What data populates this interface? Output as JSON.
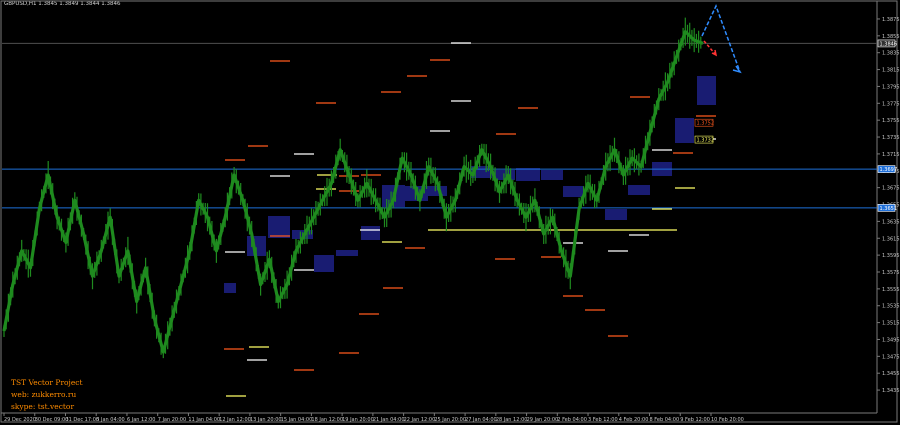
{
  "chart_header": {
    "symbol_label": "GBPUSD,H1",
    "ohlc": "1.3845 1.3849 1.3844 1.3846"
  },
  "branding": {
    "line1": "TST Vector Project",
    "line2": "web: zukkerro.ru",
    "line3": "skype: tst.vector"
  },
  "colors": {
    "background": "#000000",
    "candles": "#1f8b1f",
    "grid_line": "#4f4f4f",
    "level_line_blue": "#1e6fd9",
    "axis_text": "#c8c8c8",
    "zone_fill": "#1a1e78",
    "red_marker": "#ff5a1e",
    "white_marker": "#ffffff",
    "yellow_marker": "#ffff66",
    "arrow_blue": "#2f8cff",
    "arrow_red": "#ff3333"
  },
  "chart_data": {
    "type": "line",
    "title": "",
    "xlabel": "",
    "ylabel": "",
    "ylim": [
      1.3409,
      1.3888
    ],
    "yticks": [
      "1.3875",
      "1.3855",
      "1.3835",
      "1.3815",
      "1.3795",
      "1.3775",
      "1.3755",
      "1.3735",
      "1.3715",
      "1.3695",
      "1.3675",
      "1.3655",
      "1.3635",
      "1.3615",
      "1.3595",
      "1.3575",
      "1.3555",
      "1.3535",
      "1.3515",
      "1.3495",
      "1.3475",
      "1.3455",
      "1.3435"
    ],
    "yticks_values": [
      1.3875,
      1.3855,
      1.3835,
      1.3815,
      1.3795,
      1.3775,
      1.3755,
      1.3735,
      1.3715,
      1.3695,
      1.3675,
      1.3655,
      1.3635,
      1.3615,
      1.3595,
      1.3575,
      1.3555,
      1.3535,
      1.3515,
      1.3495,
      1.3475,
      1.3455,
      1.3435
    ],
    "xticks": [
      "29 Dec 2020",
      "30 Dec 09:00",
      "31 Dec 17:00",
      "5 Jan 04:00",
      "6 Jan 12:00",
      "7 Jan 20:00",
      "11 Jan 04:00",
      "12 Jan 12:00",
      "13 Jan 20:00",
      "15 Jan 04:00",
      "18 Jan 12:00",
      "19 Jan 20:00",
      "21 Jan 04:00",
      "22 Jan 12:00",
      "25 Jan 20:00",
      "27 Jan 04:00",
      "28 Jan 12:00",
      "29 Jan 20:00",
      "2 Feb 04:00",
      "3 Feb 12:00",
      "4 Feb 20:00",
      "8 Feb 04:00",
      "9 Feb 12:00",
      "10 Feb 20:00"
    ],
    "price_points": [
      [
        0,
        1.3505
      ],
      [
        1,
        1.356
      ],
      [
        2,
        1.36
      ],
      [
        3,
        1.358
      ],
      [
        4,
        1.365
      ],
      [
        5,
        1.369
      ],
      [
        6,
        1.364
      ],
      [
        7,
        1.361
      ],
      [
        8,
        1.366
      ],
      [
        9,
        1.362
      ],
      [
        10,
        1.357
      ],
      [
        11,
        1.36
      ],
      [
        12,
        1.364
      ],
      [
        13,
        1.357
      ],
      [
        14,
        1.36
      ],
      [
        15,
        1.354
      ],
      [
        16,
        1.358
      ],
      [
        17,
        1.352
      ],
      [
        18,
        1.348
      ],
      [
        19,
        1.352
      ],
      [
        20,
        1.356
      ],
      [
        21,
        1.36
      ],
      [
        22,
        1.366
      ],
      [
        23,
        1.364
      ],
      [
        24,
        1.36
      ],
      [
        25,
        1.364
      ],
      [
        26,
        1.369
      ],
      [
        27,
        1.366
      ],
      [
        28,
        1.362
      ],
      [
        29,
        1.356
      ],
      [
        30,
        1.359
      ],
      [
        31,
        1.354
      ],
      [
        32,
        1.356
      ],
      [
        33,
        1.36
      ],
      [
        34,
        1.362
      ],
      [
        35,
        1.364
      ],
      [
        36,
        1.366
      ],
      [
        37,
        1.368
      ],
      [
        38,
        1.372
      ],
      [
        39,
        1.369
      ],
      [
        40,
        1.366
      ],
      [
        41,
        1.368
      ],
      [
        42,
        1.366
      ],
      [
        43,
        1.364
      ],
      [
        44,
        1.366
      ],
      [
        45,
        1.371
      ],
      [
        46,
        1.369
      ],
      [
        47,
        1.366
      ],
      [
        48,
        1.37
      ],
      [
        49,
        1.368
      ],
      [
        50,
        1.364
      ],
      [
        51,
        1.366
      ],
      [
        52,
        1.37
      ],
      [
        53,
        1.369
      ],
      [
        54,
        1.372
      ],
      [
        55,
        1.37
      ],
      [
        56,
        1.367
      ],
      [
        57,
        1.369
      ],
      [
        58,
        1.366
      ],
      [
        59,
        1.364
      ],
      [
        60,
        1.366
      ],
      [
        61,
        1.362
      ],
      [
        62,
        1.364
      ],
      [
        63,
        1.36
      ],
      [
        64,
        1.357
      ],
      [
        65,
        1.365
      ],
      [
        66,
        1.368
      ],
      [
        67,
        1.366
      ],
      [
        68,
        1.37
      ],
      [
        69,
        1.372
      ],
      [
        70,
        1.369
      ],
      [
        71,
        1.371
      ],
      [
        72,
        1.37
      ],
      [
        73,
        1.374
      ],
      [
        74,
        1.378
      ],
      [
        75,
        1.38
      ],
      [
        76,
        1.383
      ],
      [
        77,
        1.386
      ],
      [
        78,
        1.385
      ],
      [
        79,
        1.3846
      ]
    ],
    "levels": {
      "gray_line": 1.3846,
      "blue_upper": 1.3697,
      "blue_lower": 1.3651
    },
    "price_labels": [
      {
        "text": "1.3846",
        "value": 1.3846,
        "color": "#ffffff",
        "bg": "#303030"
      },
      {
        "text": "1.3697",
        "value": 1.3697,
        "color": "#ffffff",
        "bg": "#1e6fd9"
      },
      {
        "text": "1.3651",
        "value": 1.3651,
        "color": "#ffffff",
        "bg": "#1e6fd9"
      },
      {
        "text": "1.3752",
        "value": 1.3752,
        "color": "#ff5a1e",
        "bg": "#000000"
      },
      {
        "text": "1.3732",
        "value": 1.3732,
        "color": "#ffff66",
        "bg": "#000000"
      }
    ]
  }
}
